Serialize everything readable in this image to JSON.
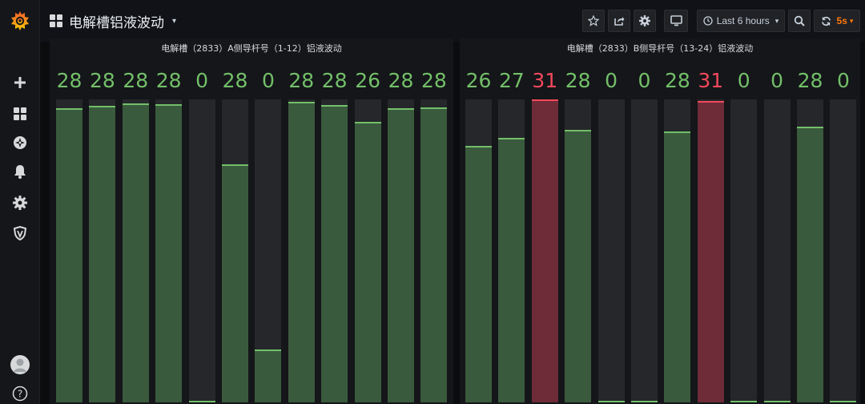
{
  "app": {
    "logo_icon": "grafana-logo-icon",
    "title": "电解槽铝液波动",
    "title_icon": "dashboard-grid-icon"
  },
  "sidebar": {
    "items": [
      {
        "name": "plus-icon"
      },
      {
        "name": "dashboards-icon"
      },
      {
        "name": "explore-compass-icon"
      },
      {
        "name": "alerting-bell-icon"
      },
      {
        "name": "configuration-gear-icon"
      },
      {
        "name": "server-admin-shield-icon"
      }
    ],
    "bottom": [
      {
        "name": "user-avatar"
      },
      {
        "name": "help-question-icon"
      }
    ]
  },
  "toolbar": {
    "star_icon": "star-icon",
    "share_icon": "share-icon",
    "settings_icon": "gear-icon",
    "tv_icon": "tv-monitor-icon",
    "time_range": "Last 6 hours",
    "zoom_icon": "zoom-out-icon",
    "refresh_icon": "refresh-icon",
    "refresh_interval": "5s"
  },
  "colors": {
    "ok_text": "#73bf69",
    "alert_text": "#f2495c",
    "ok_fill": "#3a5a3d",
    "ok_line": "#73bf69",
    "alert_fill": "#6e2b38",
    "alert_line": "#f2495c",
    "refresh_accent": "#ff780a"
  },
  "panels": [
    {
      "title": "电解槽（2833）A侧导杆号（1-12）铝液波动",
      "max": 31,
      "values": [
        28,
        28,
        28,
        28,
        0,
        28,
        0,
        28,
        28,
        26,
        28,
        28
      ],
      "status": [
        "ok",
        "ok",
        "ok",
        "ok",
        "ok",
        "ok",
        "ok",
        "ok",
        "ok",
        "ok",
        "ok",
        "ok"
      ],
      "fill_levels": [
        0.972,
        0.98,
        0.986,
        0.983,
        0.0,
        0.785,
        0.175,
        0.992,
        0.981,
        0.927,
        0.972,
        0.974
      ]
    },
    {
      "title": "电解槽（2833）B侧导杆号（13-24）铝液波动",
      "max": 31,
      "values": [
        26,
        27,
        31,
        28,
        0,
        0,
        28,
        31,
        0,
        0,
        28,
        0
      ],
      "status": [
        "ok",
        "ok",
        "alert",
        "ok",
        "ok",
        "ok",
        "ok",
        "alert",
        "ok",
        "ok",
        "ok",
        "ok"
      ],
      "fill_levels": [
        0.847,
        0.872,
        1.0,
        0.9,
        0.0,
        0.0,
        0.893,
        0.996,
        0.0,
        0.0,
        0.909,
        0.0
      ]
    }
  ]
}
